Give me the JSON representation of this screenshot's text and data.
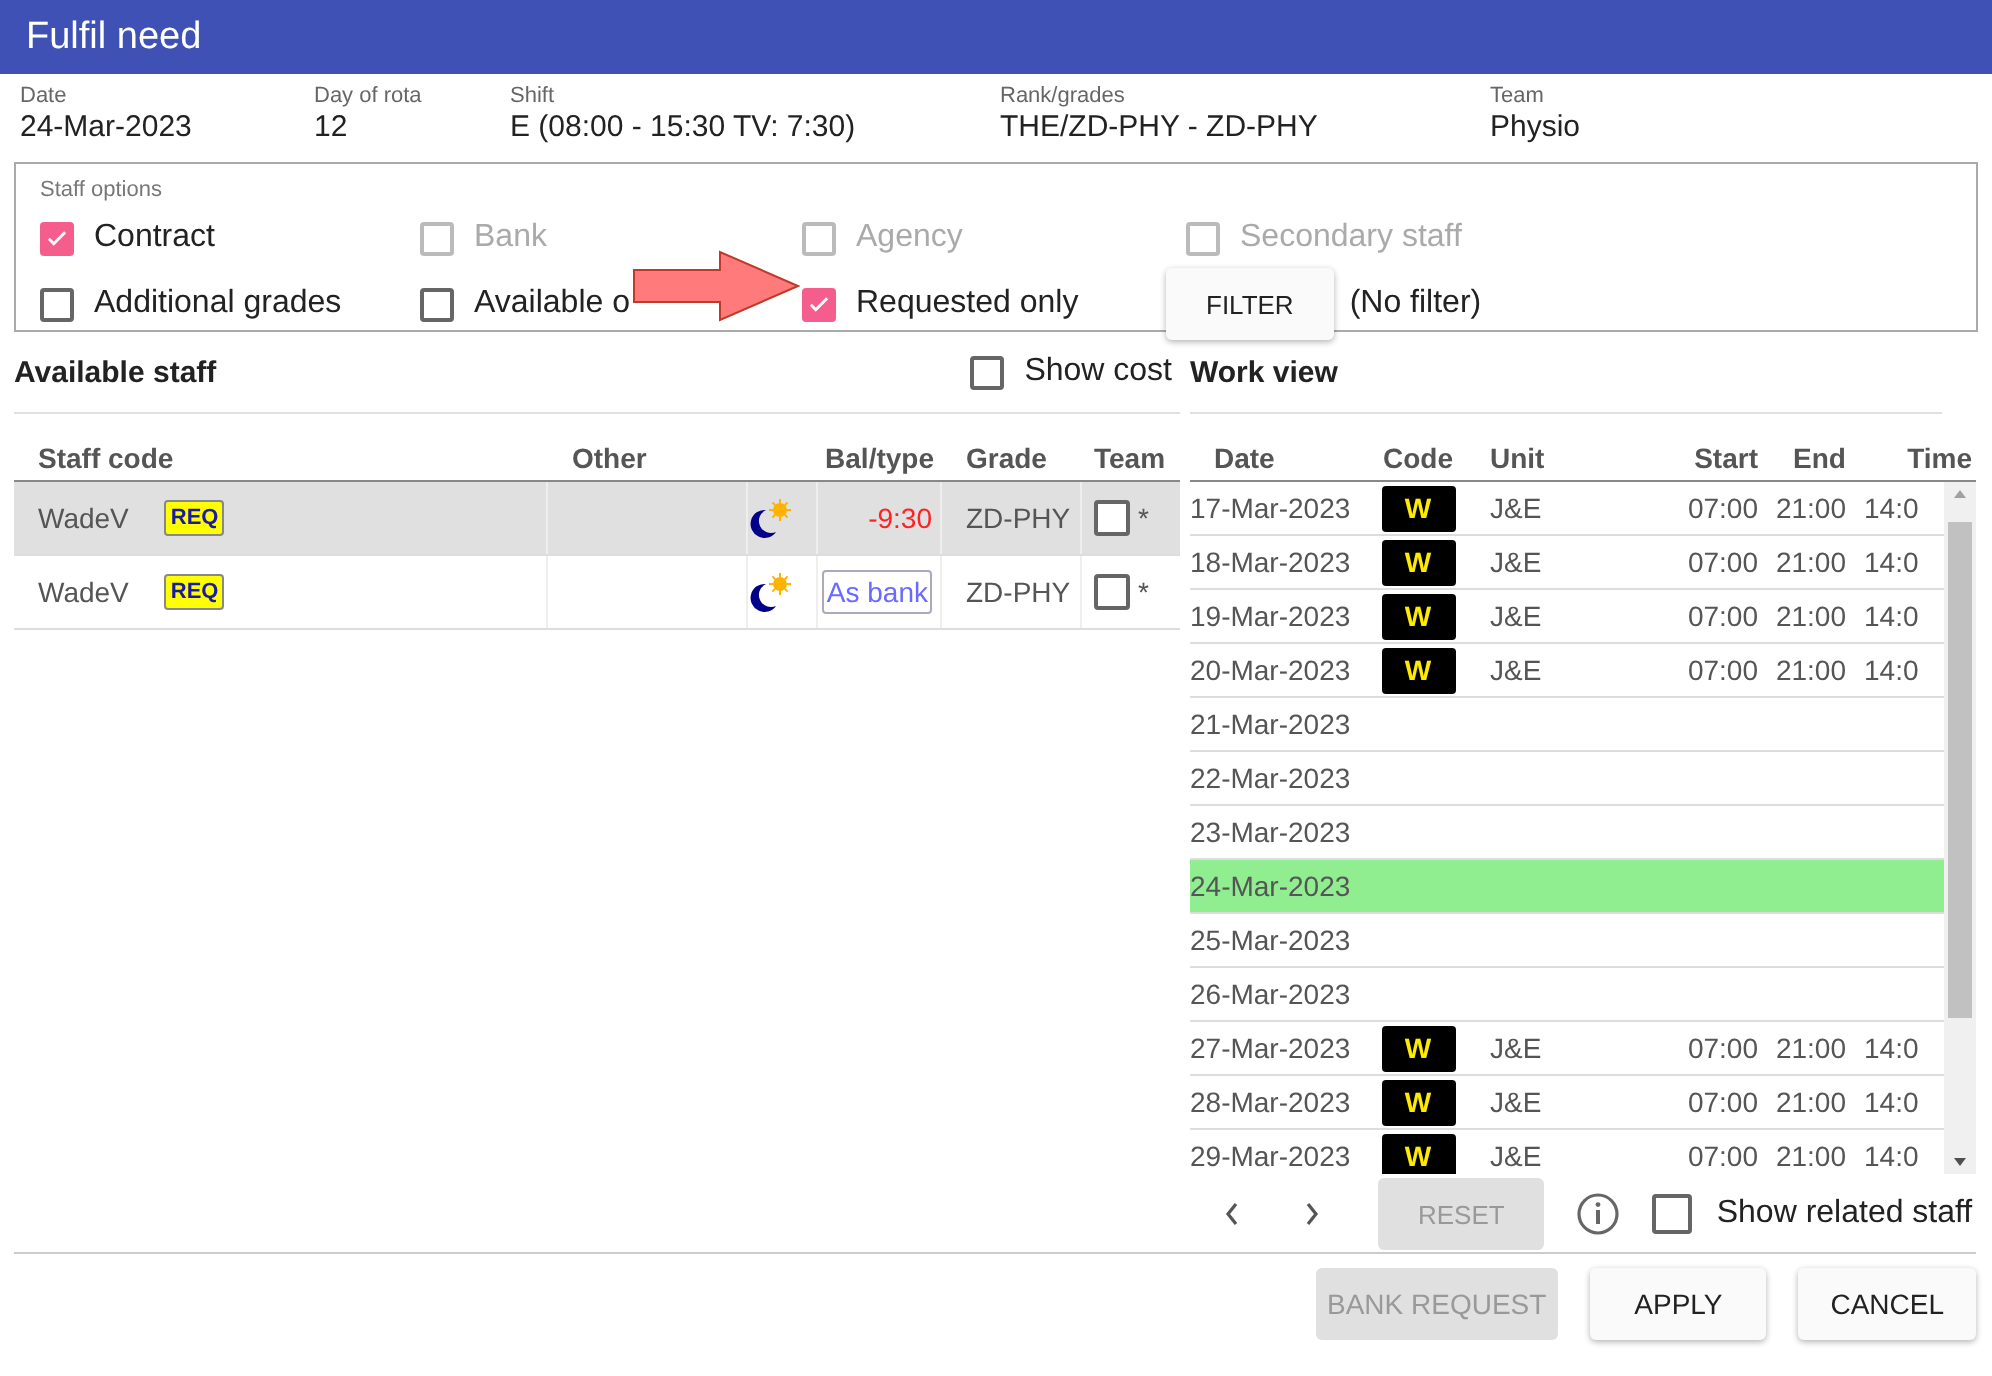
{
  "window": {
    "title": "Fulfil need"
  },
  "info": [
    {
      "label": "Date",
      "value": "24-Mar-2023"
    },
    {
      "label": "Day of rota",
      "value": "12"
    },
    {
      "label": "Shift",
      "value": "E (08:00 - 15:30 TV: 7:30)"
    },
    {
      "label": "Rank/grades",
      "value": "THE/ZD-PHY - ZD-PHY"
    },
    {
      "label": "Team",
      "value": "Physio"
    }
  ],
  "staff_options": {
    "legend": "Staff options",
    "options": [
      {
        "label": "Contract",
        "checked": true,
        "disabled": false
      },
      {
        "label": "Bank",
        "checked": false,
        "disabled": true
      },
      {
        "label": "Agency",
        "checked": false,
        "disabled": true
      },
      {
        "label": "Secondary staff",
        "checked": false,
        "disabled": true
      },
      {
        "label": "Additional grades",
        "checked": false,
        "disabled": false
      },
      {
        "label": "Available o",
        "checked": false,
        "disabled": false
      },
      {
        "label": "Requested only",
        "checked": true,
        "disabled": false
      }
    ],
    "filter_button": "FILTER",
    "filter_status": "(No filter)"
  },
  "available_staff": {
    "title": "Available staff",
    "show_cost": {
      "label": "Show cost",
      "checked": false
    },
    "columns": [
      "Staff code",
      "Other",
      "Bal/type",
      "Grade",
      "Team"
    ],
    "rows": [
      {
        "code": "WadeV",
        "badge": "REQ",
        "bal": "-9:30",
        "kind": "negative",
        "grade": "ZD-PHY",
        "team_checked": false,
        "team_mark": "*",
        "selected": true
      },
      {
        "code": "WadeV",
        "badge": "REQ",
        "bal": "As bank",
        "kind": "button",
        "grade": "ZD-PHY",
        "team_checked": false,
        "team_mark": "*",
        "selected": false
      }
    ]
  },
  "work_view": {
    "title": "Work view",
    "columns": [
      "Date",
      "Code",
      "Unit",
      "Start",
      "End",
      "Time"
    ],
    "rows": [
      {
        "date": "17-Mar-2023",
        "code": "W",
        "unit": "J&E",
        "start": "07:00",
        "end": "21:00",
        "time": "14:0",
        "highlighted": false
      },
      {
        "date": "18-Mar-2023",
        "code": "W",
        "unit": "J&E",
        "start": "07:00",
        "end": "21:00",
        "time": "14:0",
        "highlighted": false
      },
      {
        "date": "19-Mar-2023",
        "code": "W",
        "unit": "J&E",
        "start": "07:00",
        "end": "21:00",
        "time": "14:0",
        "highlighted": false
      },
      {
        "date": "20-Mar-2023",
        "code": "W",
        "unit": "J&E",
        "start": "07:00",
        "end": "21:00",
        "time": "14:0",
        "highlighted": false
      },
      {
        "date": "21-Mar-2023",
        "highlighted": false
      },
      {
        "date": "22-Mar-2023",
        "highlighted": false
      },
      {
        "date": "23-Mar-2023",
        "highlighted": false
      },
      {
        "date": "24-Mar-2023",
        "highlighted": true
      },
      {
        "date": "25-Mar-2023",
        "highlighted": false
      },
      {
        "date": "26-Mar-2023",
        "highlighted": false
      },
      {
        "date": "27-Mar-2023",
        "code": "W",
        "unit": "J&E",
        "start": "07:00",
        "end": "21:00",
        "time": "14:0",
        "highlighted": false
      },
      {
        "date": "28-Mar-2023",
        "code": "W",
        "unit": "J&E",
        "start": "07:00",
        "end": "21:00",
        "time": "14:0",
        "highlighted": false
      },
      {
        "date": "29-Mar-2023",
        "code": "W",
        "unit": "J&E",
        "start": "07:00",
        "end": "21:00",
        "time": "14:0",
        "highlighted": false
      }
    ],
    "reset_button": "RESET",
    "show_related": {
      "label": "Show related staff",
      "checked": false
    }
  },
  "buttons": [
    {
      "label": "BANK REQUEST",
      "disabled": true
    },
    {
      "label": "APPLY",
      "disabled": false
    },
    {
      "label": "CANCEL",
      "disabled": false
    }
  ]
}
